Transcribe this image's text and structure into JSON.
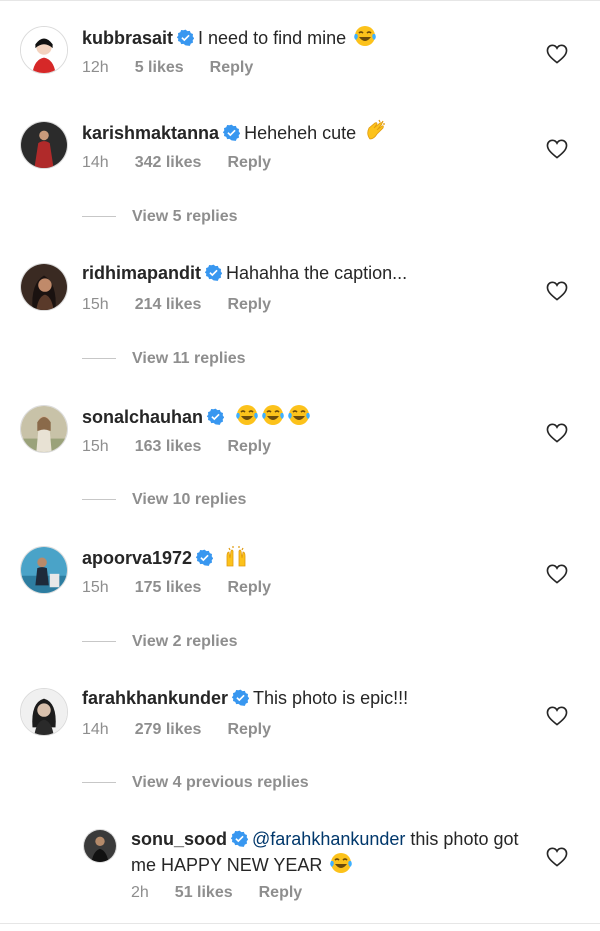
{
  "comments": [
    {
      "username": "kubbrasait",
      "text": "I need to find mine",
      "emoji": [
        "face-with-tears-of-joy"
      ],
      "time": "12h",
      "likes": "5 likes",
      "reply": "Reply"
    },
    {
      "username": "karishmaktanna",
      "text": "Heheheh cute",
      "emoji": [
        "clapping-hands"
      ],
      "time": "14h",
      "likes": "342 likes",
      "reply": "Reply",
      "view_replies": "View 5 replies"
    },
    {
      "username": "ridhimapandit",
      "text": "Hahahha the caption...",
      "emoji": [],
      "time": "15h",
      "likes": "214 likes",
      "reply": "Reply",
      "view_replies": "View 11 replies"
    },
    {
      "username": "sonalchauhan",
      "text": "",
      "emoji": [
        "face-with-tears-of-joy",
        "face-with-tears-of-joy",
        "face-with-tears-of-joy"
      ],
      "time": "15h",
      "likes": "163 likes",
      "reply": "Reply",
      "view_replies": "View 10 replies"
    },
    {
      "username": "apoorva1972",
      "text": "",
      "emoji": [
        "raising-hands"
      ],
      "time": "15h",
      "likes": "175 likes",
      "reply": "Reply",
      "view_replies": "View 2 replies"
    },
    {
      "username": "farahkhankunder",
      "text": "This photo is epic!!!",
      "emoji": [],
      "time": "14h",
      "likes": "279 likes",
      "reply": "Reply",
      "view_replies": "View 4 previous replies"
    }
  ],
  "reply": {
    "username": "sonu_sood",
    "mention": "@farahkhankunder",
    "text": "this photo got me HAPPY NEW YEAR",
    "emoji": [
      "face-with-tears-of-joy"
    ],
    "time": "2h",
    "likes": "51 likes",
    "reply": "Reply"
  },
  "colors": {
    "verified": "#3897f0",
    "meta": "#8e8e8e",
    "mention": "#00376b"
  }
}
